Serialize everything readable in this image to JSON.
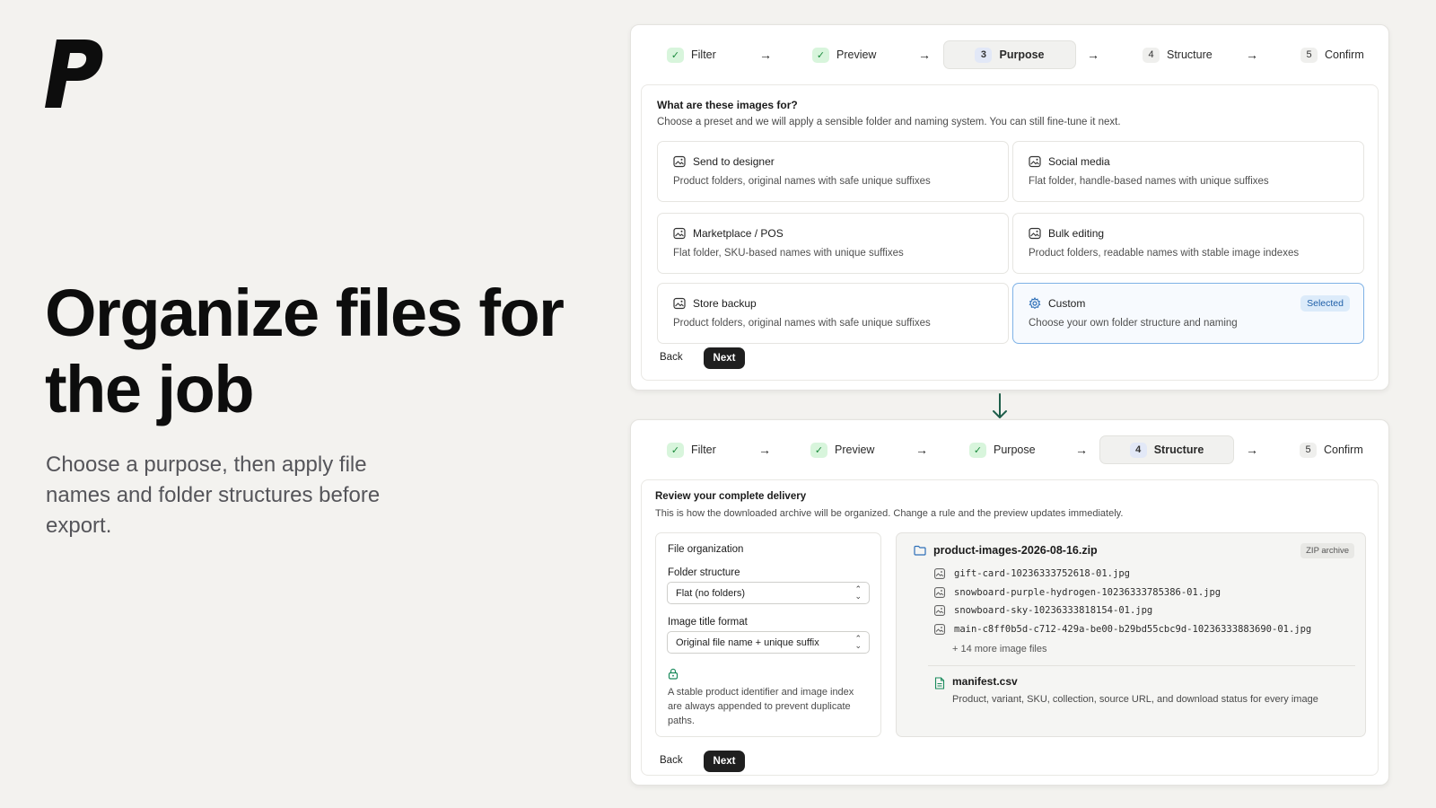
{
  "hero": {
    "title": "Organize files for the job",
    "subtitle": "Choose a purpose, then apply file names and folder structures before export."
  },
  "purpose_panel": {
    "steps": [
      {
        "label": "Filter",
        "state": "done",
        "marker": "✓"
      },
      {
        "label": "Preview",
        "state": "done",
        "marker": "✓"
      },
      {
        "label": "Purpose",
        "state": "active",
        "marker": "3"
      },
      {
        "label": "Structure",
        "state": "pending",
        "marker": "4"
      },
      {
        "label": "Confirm",
        "state": "pending",
        "marker": "5"
      }
    ],
    "arrow": "→",
    "question": "What are these images for?",
    "description": "Choose a preset and we will apply a sensible folder and naming system. You can still fine-tune it next.",
    "presets": [
      {
        "title": "Send to designer",
        "description": "Product folders, original names with safe unique suffixes",
        "icon": "image-icon"
      },
      {
        "title": "Social media",
        "description": "Flat folder, handle-based names with unique suffixes",
        "icon": "image-icon"
      },
      {
        "title": "Marketplace / POS",
        "description": "Flat folder, SKU-based names with unique suffixes",
        "icon": "image-icon"
      },
      {
        "title": "Bulk editing",
        "description": "Product folders, readable names with stable image indexes",
        "icon": "image-icon"
      },
      {
        "title": "Store backup",
        "description": "Product folders, original names with safe unique suffixes",
        "icon": "image-icon"
      },
      {
        "title": "Custom",
        "description": "Choose your own folder structure and naming",
        "icon": "gear-icon",
        "selected": true,
        "badge": "Selected"
      }
    ],
    "back_label": "Back",
    "next_label": "Next"
  },
  "structure_panel": {
    "steps": [
      {
        "label": "Filter",
        "state": "done",
        "marker": "✓"
      },
      {
        "label": "Preview",
        "state": "done",
        "marker": "✓"
      },
      {
        "label": "Purpose",
        "state": "done",
        "marker": "✓"
      },
      {
        "label": "Structure",
        "state": "active",
        "marker": "4"
      },
      {
        "label": "Confirm",
        "state": "pending",
        "marker": "5"
      }
    ],
    "arrow": "→",
    "title": "Review your complete delivery",
    "description": "This is how the downloaded archive will be organized. Change a rule and the preview updates immediately.",
    "file_organization": {
      "title": "File organization",
      "folder_structure_label": "Folder structure",
      "folder_structure_value": "Flat (no folders)",
      "image_title_label": "Image title format",
      "image_title_value": "Original file name + unique suffix",
      "note": "A stable product identifier and image index are always appended to prevent duplicate paths."
    },
    "archive": {
      "name": "product-images-2026-08-16.zip",
      "badge": "ZIP archive",
      "files": [
        "gift-card-10236333752618-01.jpg",
        "snowboard-purple-hydrogen-10236333785386-01.jpg",
        "snowboard-sky-10236333818154-01.jpg",
        "main-c8ff0b5d-c712-429a-be00-b29bd55cbc9d-10236333883690-01.jpg"
      ],
      "more_files": "+ 14 more image files",
      "manifest_name": "manifest.csv",
      "manifest_description": "Product, variant, SKU, collection, source URL, and download status for every image"
    },
    "back_label": "Back",
    "next_label": "Next"
  },
  "colors": {
    "background": "#f3f2ef",
    "accent_green": "#1a8a3c",
    "selected_border": "#7fb2e6",
    "flow_arrow": "#1e5e4a"
  }
}
